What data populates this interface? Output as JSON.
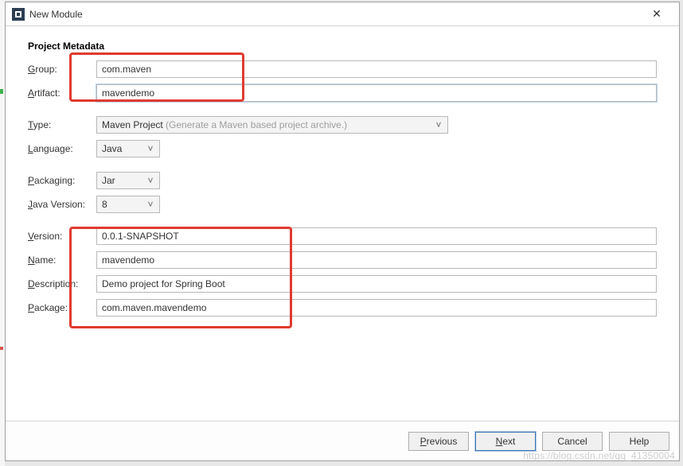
{
  "window": {
    "title": "New Module"
  },
  "heading": "Project Metadata",
  "labels": {
    "group": "roup:",
    "artifact": "rtifact:",
    "type": "ype:",
    "language": "anguage:",
    "packaging": "ackaging:",
    "javaVersion": "ava Version:",
    "version": "ersion:",
    "name": "ame:",
    "description": "escription:",
    "package": "ackage:"
  },
  "mnemonics": {
    "group": "G",
    "artifact": "A",
    "type": "T",
    "language": "L",
    "packaging": "P",
    "javaVersion": "J",
    "version": "V",
    "name": "N",
    "description": "D",
    "package": "P"
  },
  "values": {
    "group": "com.maven",
    "artifact": "mavendemo",
    "type": "Maven Project",
    "typeHint": "(Generate a Maven based project archive.)",
    "language": "Java",
    "packaging": "Jar",
    "javaVersion": "8",
    "version": "0.0.1-SNAPSHOT",
    "name": "mavendemo",
    "description": "Demo project for Spring Boot",
    "package": "com.maven.mavendemo"
  },
  "buttons": {
    "previous": "revious",
    "previousM": "P",
    "next": "ext",
    "nextM": "N",
    "cancel": "Cancel",
    "help": "Help"
  },
  "watermark": "https://blog.csdn.net/qq_41350004"
}
